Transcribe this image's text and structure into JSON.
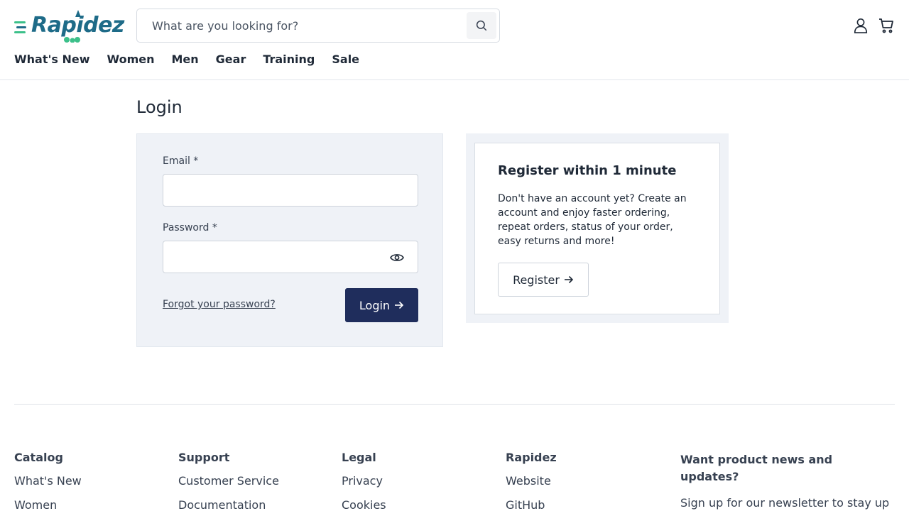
{
  "header": {
    "logo_text": "Rapidez",
    "search": {
      "placeholder": "What are you looking for?"
    },
    "icons": {
      "search": "search-icon",
      "account": "user-icon",
      "cart": "cart-icon"
    },
    "nav": [
      "What's New",
      "Women",
      "Men",
      "Gear",
      "Training",
      "Sale"
    ]
  },
  "main": {
    "title": "Login",
    "login": {
      "email_label": "Email *",
      "email_value": "",
      "password_label": "Password *",
      "password_value": "",
      "forgot_label": "Forgot your password?",
      "submit_label": "Login"
    },
    "register": {
      "title": "Register within 1 minute",
      "text": "Don't have an account yet? Create an account and enjoy faster ordering, repeat orders, status of your order, easy returns and more!",
      "button_label": "Register"
    }
  },
  "footer": {
    "columns": [
      {
        "title": "Catalog",
        "links": [
          "What's New",
          "Women"
        ]
      },
      {
        "title": "Support",
        "links": [
          "Customer Service",
          "Documentation"
        ]
      },
      {
        "title": "Legal",
        "links": [
          "Privacy",
          "Cookies"
        ]
      },
      {
        "title": "Rapidez",
        "links": [
          "Website",
          "GitHub"
        ]
      }
    ],
    "newsletter": {
      "title": "Want product news and updates?",
      "text": "Sign up for our newsletter to stay up"
    }
  },
  "colors": {
    "brand": "#1e6b88",
    "accent_green": "#3cc08a",
    "primary_button": "#1f2d5c",
    "panel": "#eff2f7"
  }
}
